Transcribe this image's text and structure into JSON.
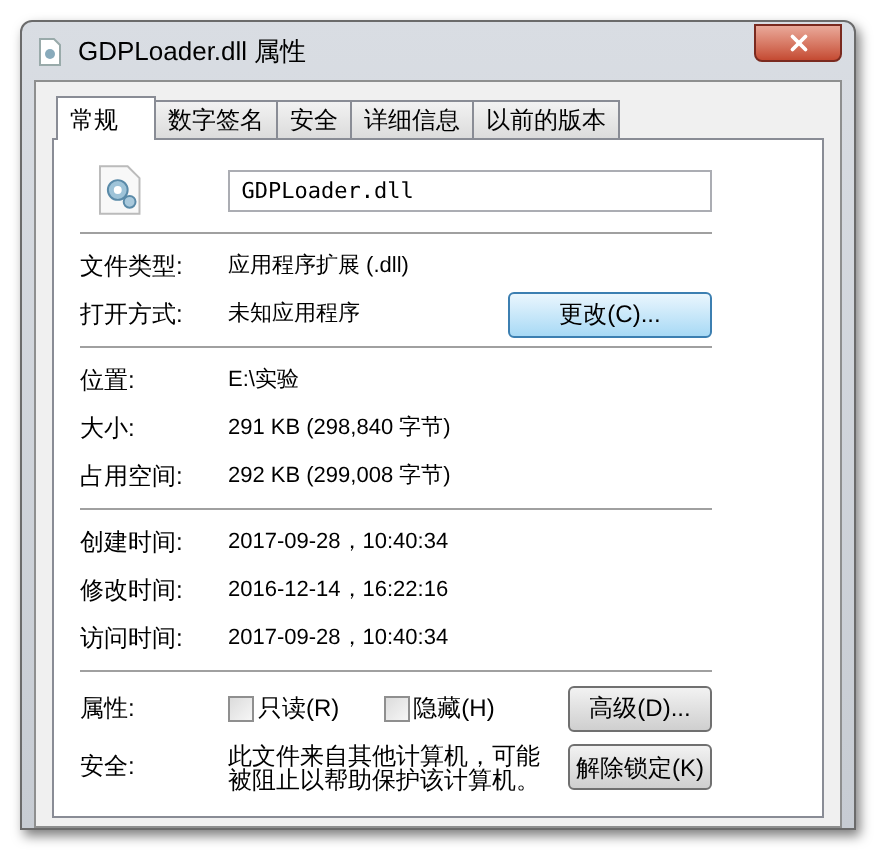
{
  "window": {
    "title": "GDPLoader.dll 属性"
  },
  "tabs": [
    {
      "label": "常规",
      "selected": true
    },
    {
      "label": "数字签名",
      "selected": false
    },
    {
      "label": "安全",
      "selected": false
    },
    {
      "label": "详细信息",
      "selected": false
    },
    {
      "label": "以前的版本",
      "selected": false
    }
  ],
  "file": {
    "name": "GDPLoader.dll"
  },
  "sections": [
    [
      {
        "label": "文件类型:",
        "value": "应用程序扩展 (.dll)"
      },
      {
        "label": "打开方式:",
        "value": "未知应用程序",
        "button": "更改(C)..."
      }
    ],
    [
      {
        "label": "位置:",
        "value": "E:\\实验"
      },
      {
        "label": "大小:",
        "value": "291 KB (298,840 字节)"
      },
      {
        "label": "占用空间:",
        "value": "292 KB (299,008 字节)"
      }
    ],
    [
      {
        "label": "创建时间:",
        "value": "2017-09-28，10:40:34"
      },
      {
        "label": "修改时间:",
        "value": "2016-12-14，16:22:16"
      },
      {
        "label": "访问时间:",
        "value": "2017-09-28，10:40:34"
      }
    ]
  ],
  "attributes": {
    "label": "属性:",
    "checkboxes": [
      {
        "label": "只读(R)",
        "checked": false
      },
      {
        "label": "隐藏(H)",
        "checked": false
      }
    ],
    "button": "高级(D)..."
  },
  "security": {
    "label": "安全:",
    "text": "此文件来自其他计算机，可能被阻止以帮助保护该计算机。",
    "button": "解除锁定(K)"
  }
}
